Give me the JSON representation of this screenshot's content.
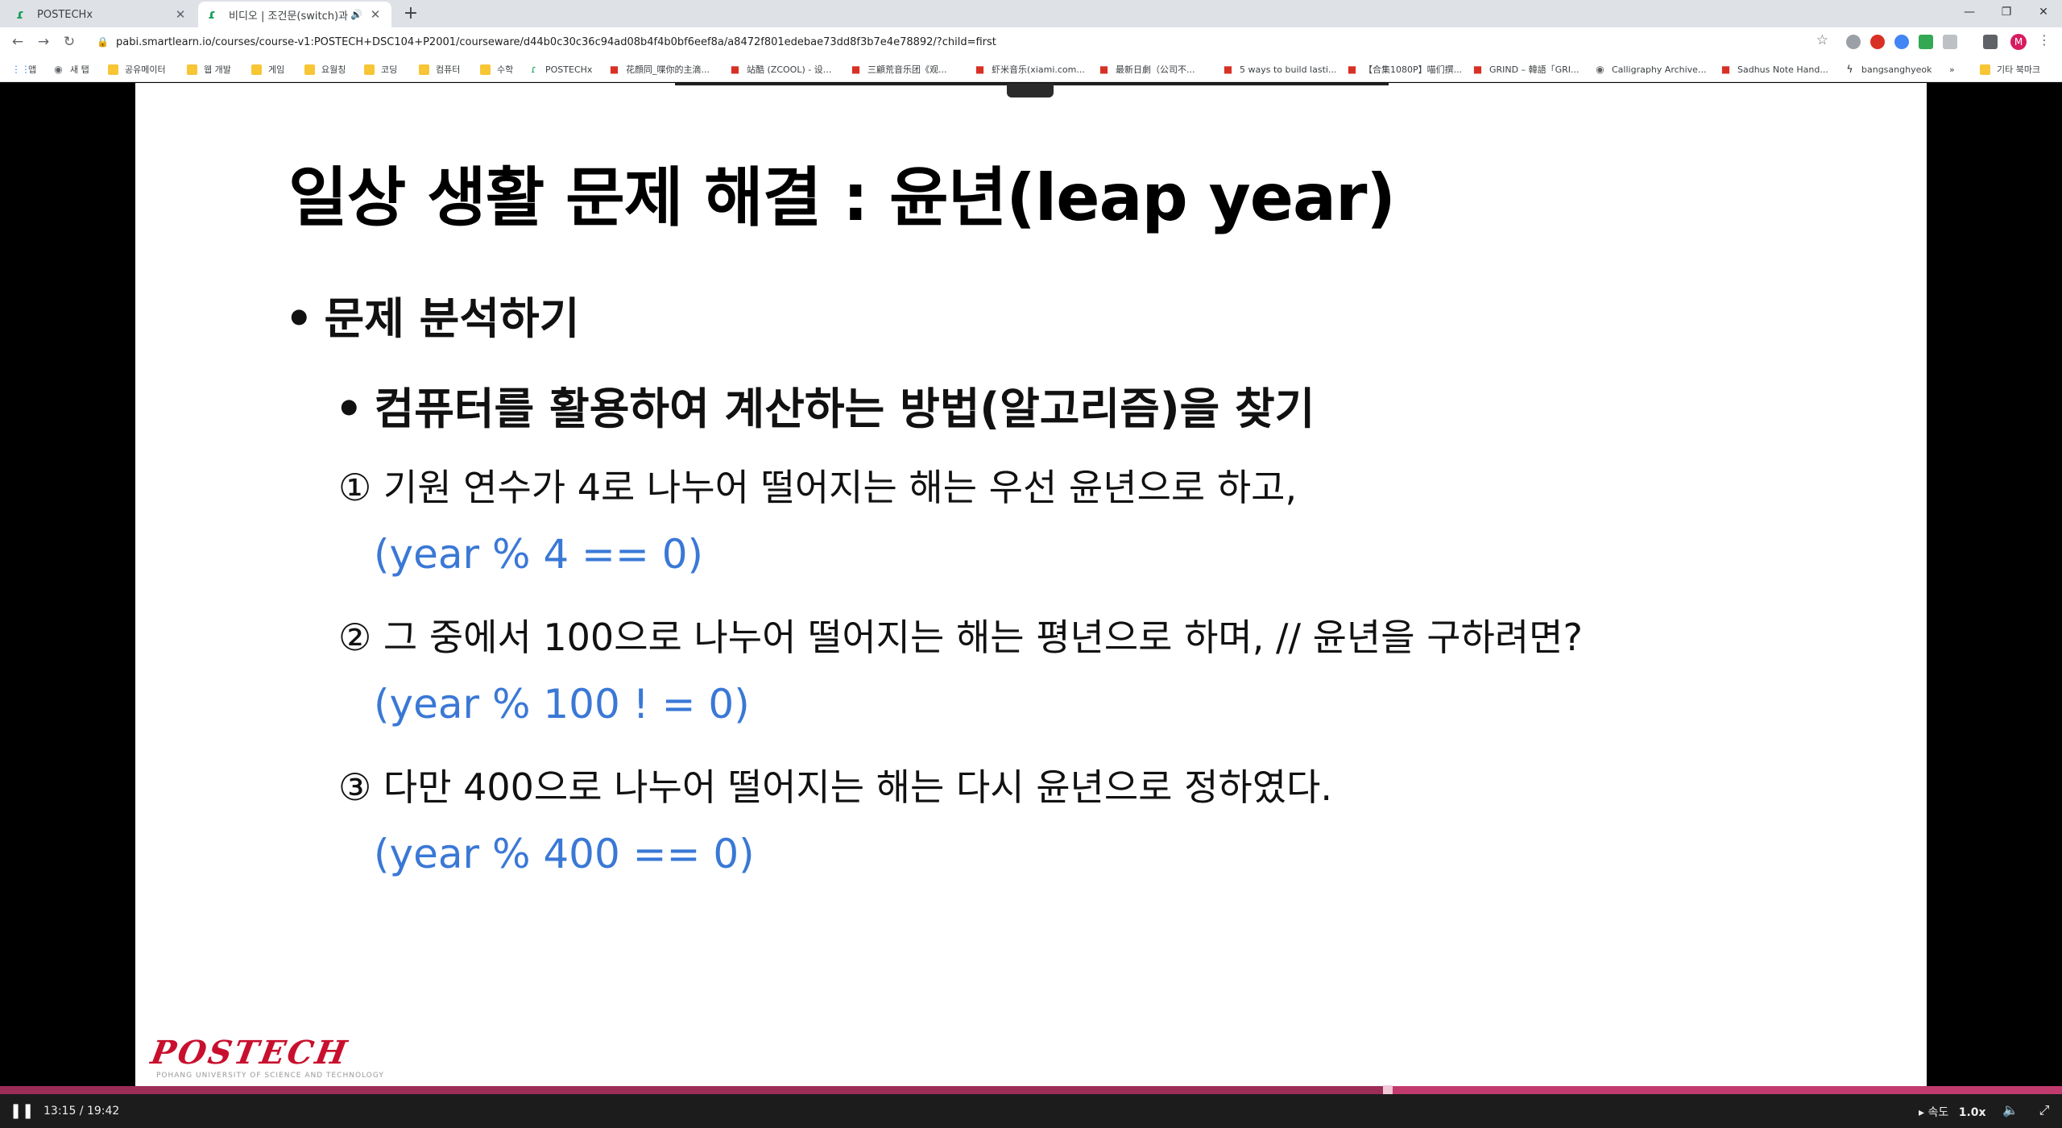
{
  "browser": {
    "tabs": [
      {
        "title": "POSTECHx",
        "active": false
      },
      {
        "title": "비디오 | 조건문(switch)과 반",
        "active": true
      }
    ],
    "new_tab_icon": "plus-icon",
    "window_controls": [
      "minimize-icon",
      "restore-icon",
      "close-icon"
    ],
    "url": "pabi.smartlearn.io/courses/course-v1:POSTECH+DSC104+P2001/courseware/d44b0c30c36c94ad08b4f4b0bf6eef8a/a8472f801edebae73dd8f3b7e4e78892/?child=first",
    "avatar_letter": "M",
    "bookmarks": [
      {
        "label": "앱",
        "icon": "apps-icon"
      },
      {
        "label": "새 탭",
        "icon": "globe-icon"
      },
      {
        "label": "공유메이터",
        "icon": "folder-icon"
      },
      {
        "label": "웹 개발",
        "icon": "folder-icon"
      },
      {
        "label": "게임",
        "icon": "folder-icon"
      },
      {
        "label": "요월칭",
        "icon": "folder-icon"
      },
      {
        "label": "코딩",
        "icon": "folder-icon"
      },
      {
        "label": "컴퓨터",
        "icon": "folder-icon"
      },
      {
        "label": "수학",
        "icon": "folder-icon"
      },
      {
        "label": "POSTECHx",
        "icon": "postech-icon"
      },
      {
        "label": "花顔同_喋你的主滴...",
        "icon": "site-icon"
      },
      {
        "label": "站酷 (ZCOOL) - 设...",
        "icon": "site-icon"
      },
      {
        "label": "三顧荒音乐团《观...",
        "icon": "site-icon"
      },
      {
        "label": "虾米音乐(xiami.com...",
        "icon": "site-icon"
      },
      {
        "label": "最新日劇（公司不...",
        "icon": "site-icon"
      },
      {
        "label": "5 ways to build lasti...",
        "icon": "site-icon"
      },
      {
        "label": "【合集1080P】喵们撰...",
        "icon": "site-icon"
      },
      {
        "label": "GRIND – 韓語「GRI...",
        "icon": "site-icon"
      },
      {
        "label": "Calligraphy Archive...",
        "icon": "globe-icon"
      },
      {
        "label": "Sadhus Note Hand...",
        "icon": "site-icon"
      },
      {
        "label": "bangsanghyeok",
        "icon": "bolt-icon"
      }
    ],
    "bookmarks_more": "»",
    "other_bookmarks": "기타 북마크"
  },
  "slide": {
    "title": "일상 생활 문제 해결 : 윤년(leap year)",
    "bullet1": "문제 분석하기",
    "bullet2": "컴퓨터를 활용하여 계산하는 방법(알고리즘)을 찾기",
    "bullet_char": "•",
    "steps": [
      {
        "num": "①",
        "text": "기원 연수가 4로 나누어 떨어지는 해는 우선 윤년으로 하고,",
        "code": "(year % 4 == 0)"
      },
      {
        "num": "②",
        "text": "그 중에서 100으로 나누어 떨어지는 해는 평년으로 하며, // 윤년을 구하려면?",
        "code": "(year % 100 ! = 0)"
      },
      {
        "num": "③",
        "text": "다만 400으로 나누어 떨어지는 해는 다시 윤년으로 정하였다.",
        "code": "(year % 400 == 0)"
      }
    ],
    "code_color": "#3a78d6",
    "logo": "POSTECH",
    "logo_sub": "POHANG UNIVERSITY OF SCIENCE AND TECHNOLOGY",
    "brand_color": "#c8102e"
  },
  "player": {
    "time": "13:15 / 19:42",
    "progress_fraction": 0.673,
    "speed_label": "속도",
    "speed_value": "1.0x",
    "progress_color": "#c23b6e"
  }
}
